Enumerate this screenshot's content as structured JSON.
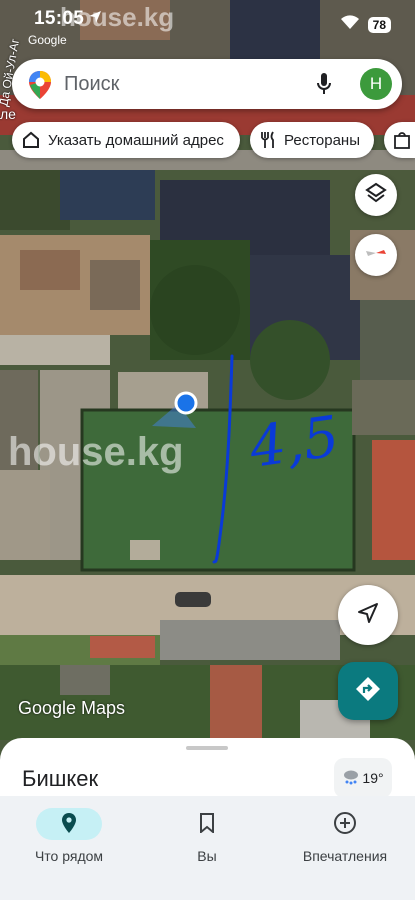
{
  "status_bar": {
    "time": "15:05",
    "back_app": "Google",
    "battery": "78"
  },
  "watermarks": [
    "house.kg",
    "house.kg"
  ],
  "search": {
    "placeholder": "Поиск",
    "avatar_letter": "Н"
  },
  "chips": [
    {
      "label": "Указать домашний адрес",
      "icon": "home-icon"
    },
    {
      "label": "Рестораны",
      "icon": "restaurant-icon"
    },
    {
      "label": "",
      "icon": "shopping-bag-icon"
    }
  ],
  "map": {
    "street_label": "ле",
    "vertical_street": "Да Ой-Ул-Аг",
    "handwritten_note": "4,5",
    "attribution": "Google Maps",
    "layers_icon": "layers-icon",
    "compass_icon": "compass-icon",
    "location_icon": "my-location-icon",
    "directions_icon": "directions-icon"
  },
  "sheet": {
    "city": "Бишкек",
    "temperature": "19°",
    "weather_icon": "snow-cloud-icon"
  },
  "nav": [
    {
      "label": "Что рядом",
      "icon": "explore-pin-icon",
      "active": true
    },
    {
      "label": "Вы",
      "icon": "bookmark-icon",
      "active": false
    },
    {
      "label": "Впечатления",
      "icon": "add-circle-icon",
      "active": false
    }
  ],
  "colors": {
    "accent": "#0b7a7f",
    "active_pill": "#c6f0f5",
    "marker": "#1a73e8",
    "pen": "#0a3ad8"
  }
}
